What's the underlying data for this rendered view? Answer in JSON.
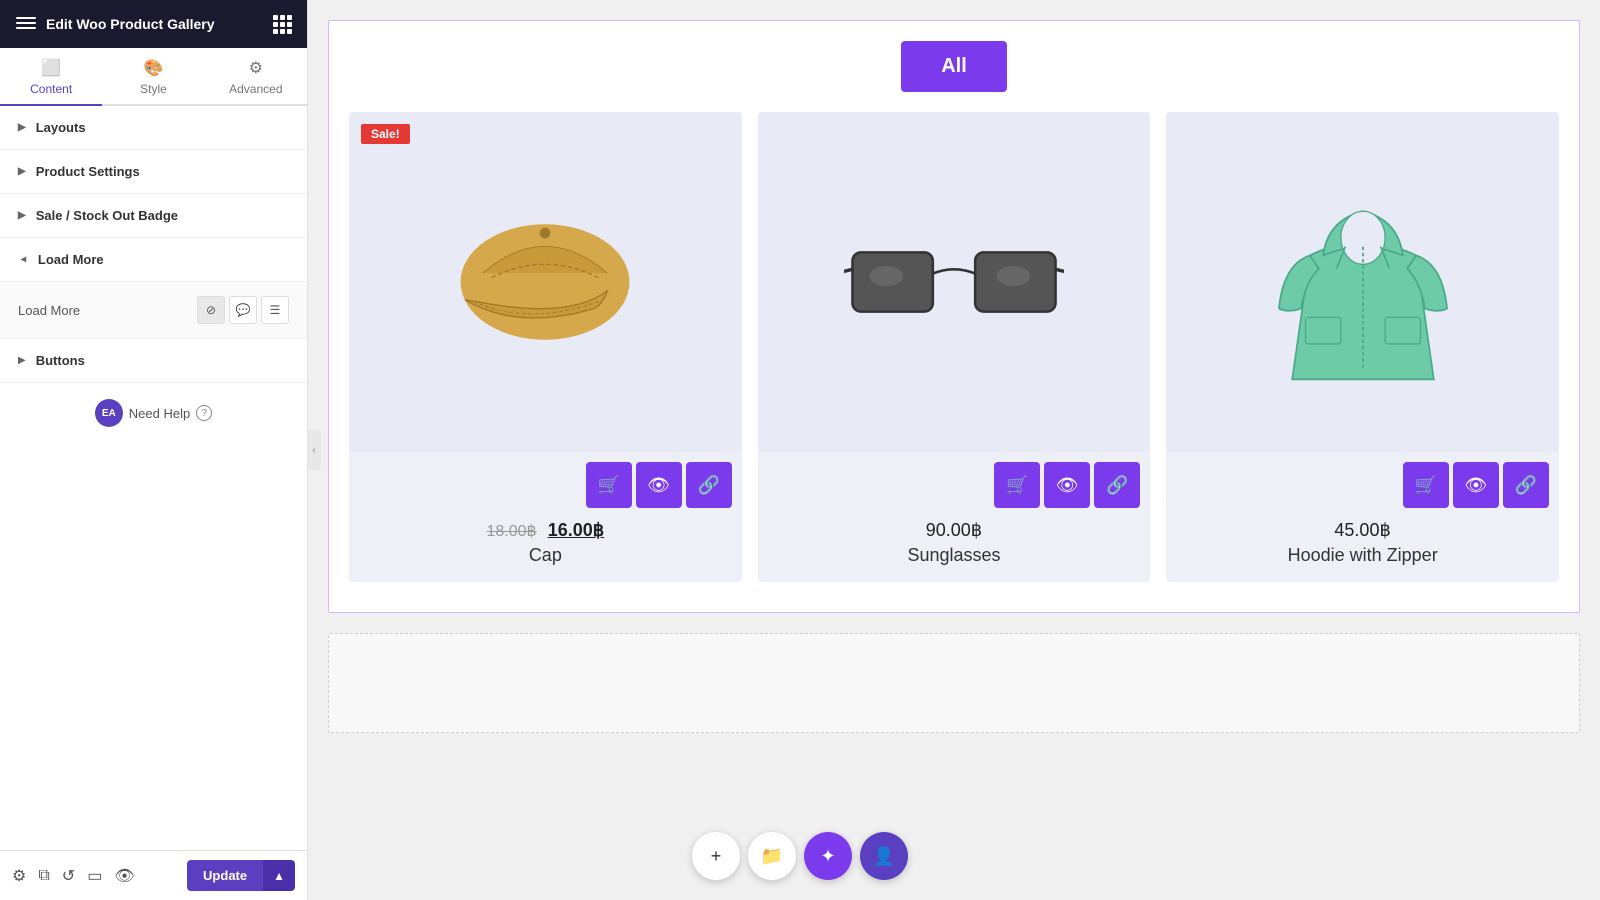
{
  "header": {
    "title": "Edit Woo Product Gallery",
    "hamburger_label": "menu",
    "grid_label": "apps"
  },
  "tabs": [
    {
      "id": "content",
      "label": "Content",
      "icon": "⬜",
      "active": true
    },
    {
      "id": "style",
      "label": "Style",
      "icon": "🎨",
      "active": false
    },
    {
      "id": "advanced",
      "label": "Advanced",
      "icon": "⚙",
      "active": false
    }
  ],
  "sections": [
    {
      "id": "layouts",
      "label": "Layouts",
      "open": false
    },
    {
      "id": "product-settings",
      "label": "Product Settings",
      "open": false
    },
    {
      "id": "sale-badge",
      "label": "Sale / Stock Out Badge",
      "open": false
    },
    {
      "id": "load-more",
      "label": "Load More",
      "open": true
    },
    {
      "id": "buttons",
      "label": "Buttons",
      "open": false
    }
  ],
  "load_more": {
    "label": "Load More",
    "controls": [
      "block",
      "message",
      "list"
    ]
  },
  "need_help": {
    "badge": "EA",
    "text": "Need Help",
    "icon": "?"
  },
  "footer": {
    "icons": [
      "settings",
      "layers",
      "history",
      "responsive",
      "eye"
    ],
    "update_label": "Update",
    "arrow_label": "▲"
  },
  "canvas": {
    "filter_buttons": [
      {
        "label": "All",
        "active": true
      }
    ],
    "products": [
      {
        "name": "Cap",
        "price": "16.00",
        "original_price": "18.00",
        "currency": "฿",
        "on_sale": true,
        "type": "cap"
      },
      {
        "name": "Sunglasses",
        "price": "90.00",
        "currency": "฿",
        "on_sale": false,
        "type": "sunglasses"
      },
      {
        "name": "Hoodie with Zipper",
        "price": "45.00",
        "currency": "฿",
        "on_sale": false,
        "type": "hoodie"
      }
    ]
  },
  "bottom_toolbar": {
    "buttons": [
      {
        "icon": "+",
        "style": "light"
      },
      {
        "icon": "📁",
        "style": "light"
      },
      {
        "icon": "✦",
        "style": "purple"
      },
      {
        "icon": "👤",
        "style": "dark"
      }
    ]
  }
}
